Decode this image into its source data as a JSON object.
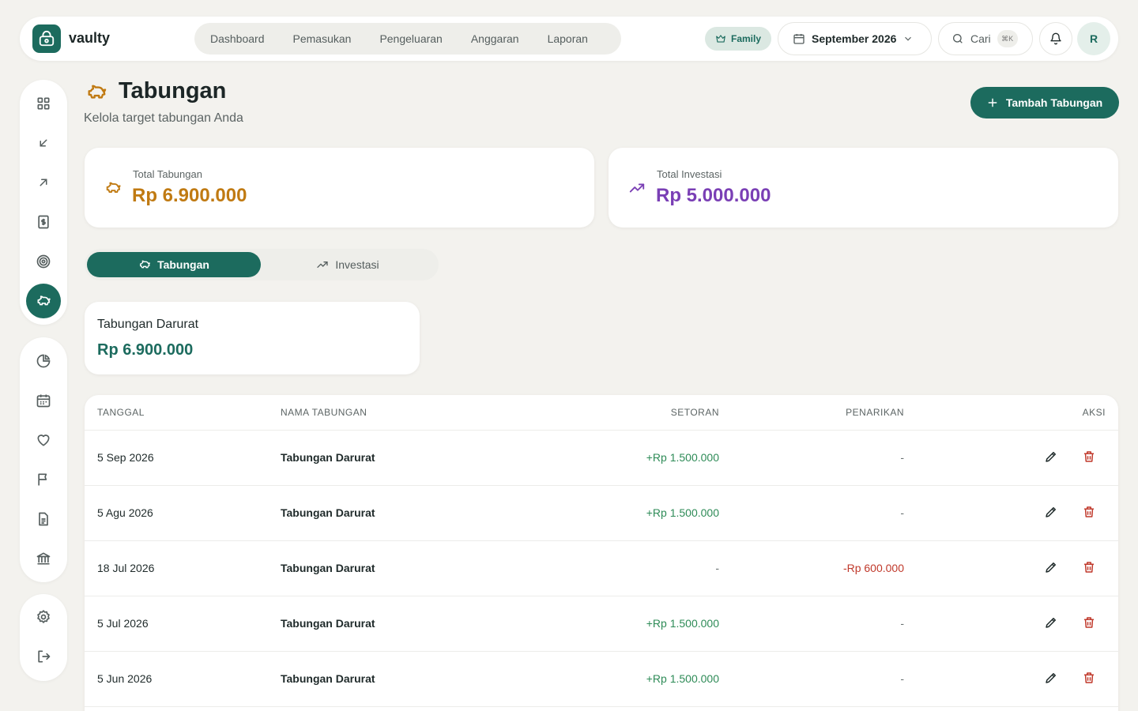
{
  "app": {
    "name": "vaulty"
  },
  "nav": {
    "items": [
      "Dashboard",
      "Pemasukan",
      "Pengeluaran",
      "Anggaran",
      "Laporan"
    ]
  },
  "topbar": {
    "family_label": "Family",
    "period": "September 2026",
    "search_label": "Cari",
    "search_shortcut": "⌘K",
    "avatar_initial": "R"
  },
  "page": {
    "title": "Tabungan",
    "subtitle": "Kelola target tabungan Anda",
    "add_button": "Tambah Tabungan"
  },
  "summary": {
    "savings_label": "Total Tabungan",
    "savings_value": "Rp 6.900.000",
    "investment_label": "Total Investasi",
    "investment_value": "Rp 5.000.000"
  },
  "tabs": {
    "savings": "Tabungan",
    "investment": "Investasi"
  },
  "goal": {
    "name": "Tabungan Darurat",
    "amount": "Rp 6.900.000"
  },
  "table": {
    "headers": {
      "date": "TANGGAL",
      "name": "NAMA TABUNGAN",
      "deposit": "SETORAN",
      "withdrawal": "PENARIKAN",
      "actions": "AKSI"
    },
    "rows": [
      {
        "date": "5 Sep 2026",
        "name": "Tabungan Darurat",
        "deposit": "+Rp 1.500.000",
        "withdrawal": "-"
      },
      {
        "date": "5 Agu 2026",
        "name": "Tabungan Darurat",
        "deposit": "+Rp 1.500.000",
        "withdrawal": "-"
      },
      {
        "date": "18 Jul 2026",
        "name": "Tabungan Darurat",
        "deposit": "-",
        "withdrawal": "-Rp 600.000"
      },
      {
        "date": "5 Jul 2026",
        "name": "Tabungan Darurat",
        "deposit": "+Rp 1.500.000",
        "withdrawal": "-"
      },
      {
        "date": "5 Jun 2026",
        "name": "Tabungan Darurat",
        "deposit": "+Rp 1.500.000",
        "withdrawal": "-"
      }
    ]
  },
  "colors": {
    "primary": "#1c6b5e",
    "savings_accent": "#c07a12",
    "investment_accent": "#7a3fb5",
    "positive": "#2e8b57",
    "negative": "#c0392b"
  },
  "icons": {
    "sidebar_primary": [
      "grid-icon",
      "arrow-down-left-icon",
      "arrow-up-right-icon",
      "receipt-icon",
      "target-icon",
      "piggy-bank-icon"
    ],
    "sidebar_secondary": [
      "pie-chart-icon",
      "calendar-icon",
      "heart-icon",
      "flag-icon",
      "document-icon",
      "bank-icon"
    ],
    "sidebar_bottom": [
      "settings-icon",
      "logout-icon"
    ]
  }
}
